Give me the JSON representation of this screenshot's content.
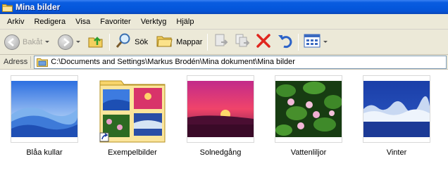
{
  "window": {
    "title": "Mina bilder"
  },
  "menu": [
    "Arkiv",
    "Redigera",
    "Visa",
    "Favoriter",
    "Verktyg",
    "Hjälp"
  ],
  "toolbar": {
    "back_label": "Bakåt",
    "search_label": "Sök",
    "folders_label": "Mappar"
  },
  "address": {
    "label": "Adress",
    "path": "C:\\Documents and Settings\\Markus Brodén\\Mina dokument\\Mina bilder"
  },
  "items": [
    {
      "name": "Blåa kullar",
      "type": "image",
      "icon": "blue-hills-thumbnail"
    },
    {
      "name": "Exempelbilder",
      "type": "folder-shortcut",
      "icon": "folder-thumbnail"
    },
    {
      "name": "Solnedgång",
      "type": "image",
      "icon": "sunset-thumbnail"
    },
    {
      "name": "Vattenliljor",
      "type": "image",
      "icon": "water-lilies-thumbnail"
    },
    {
      "name": "Vinter",
      "type": "image",
      "icon": "winter-thumbnail"
    }
  ],
  "colors": {
    "titlebar": "#0558dd",
    "chrome": "#ece9d8",
    "delete_red": "#e0261e"
  }
}
